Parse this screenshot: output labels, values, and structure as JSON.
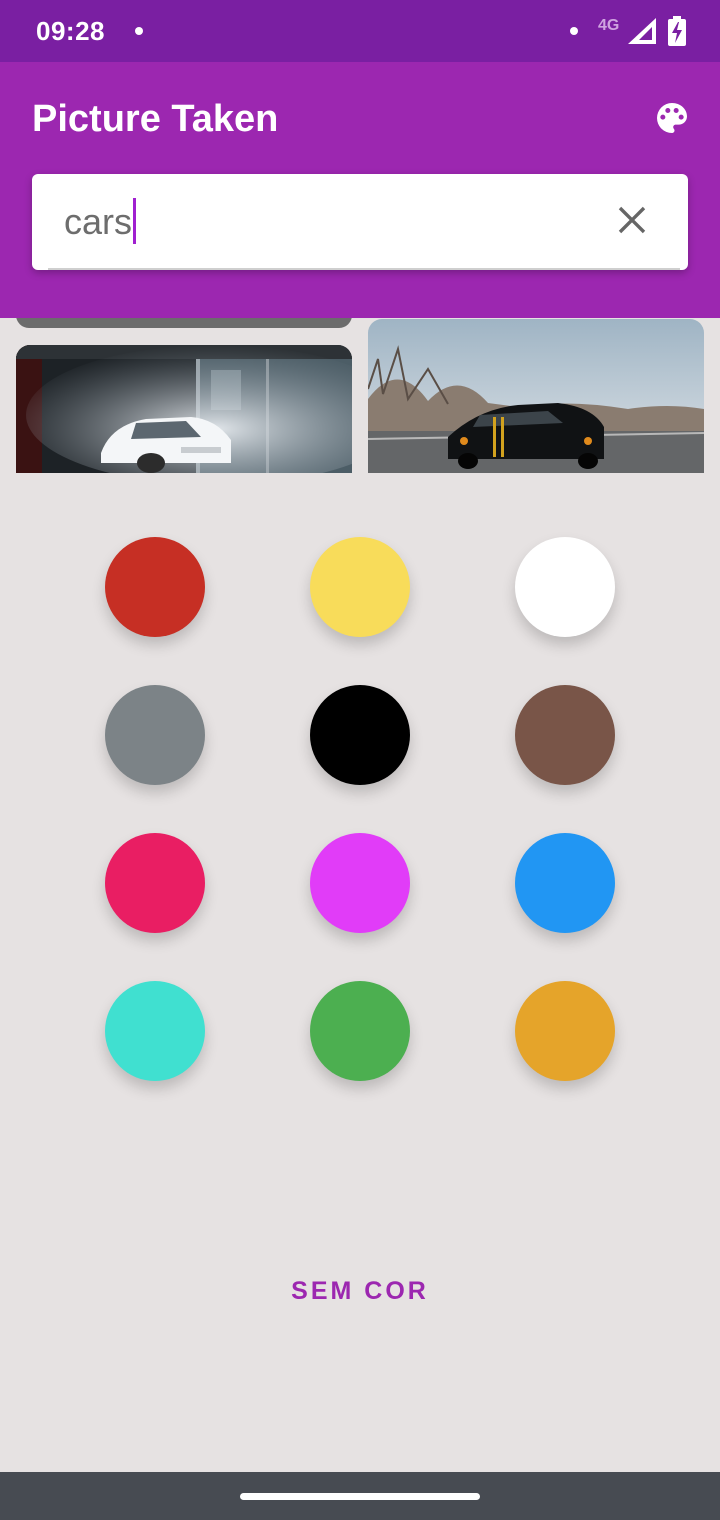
{
  "status_bar": {
    "time": "09:28",
    "network": "4G"
  },
  "app_bar": {
    "title": "Picture Taken",
    "action_icon": "palette-icon"
  },
  "search": {
    "value": "cars",
    "clear_icon": "close-icon"
  },
  "colors": {
    "swatches": [
      {
        "name": "red",
        "hex": "#c62f24"
      },
      {
        "name": "yellow",
        "hex": "#f8dc5a"
      },
      {
        "name": "white",
        "hex": "#ffffff"
      },
      {
        "name": "gray",
        "hex": "#7c8387"
      },
      {
        "name": "black",
        "hex": "#000000"
      },
      {
        "name": "brown",
        "hex": "#795548"
      },
      {
        "name": "pink",
        "hex": "#e91e63"
      },
      {
        "name": "magenta",
        "hex": "#e13cf8"
      },
      {
        "name": "blue",
        "hex": "#2196f3"
      },
      {
        "name": "turquoise",
        "hex": "#40e0d0"
      },
      {
        "name": "green",
        "hex": "#4caf50"
      },
      {
        "name": "orange",
        "hex": "#e5a42a"
      }
    ]
  },
  "actions": {
    "no_color_label": "SEM COR"
  },
  "theme": {
    "primary": "#9c27b0",
    "primary_dark": "#7a1fa2",
    "background": "#e6e2e2"
  }
}
